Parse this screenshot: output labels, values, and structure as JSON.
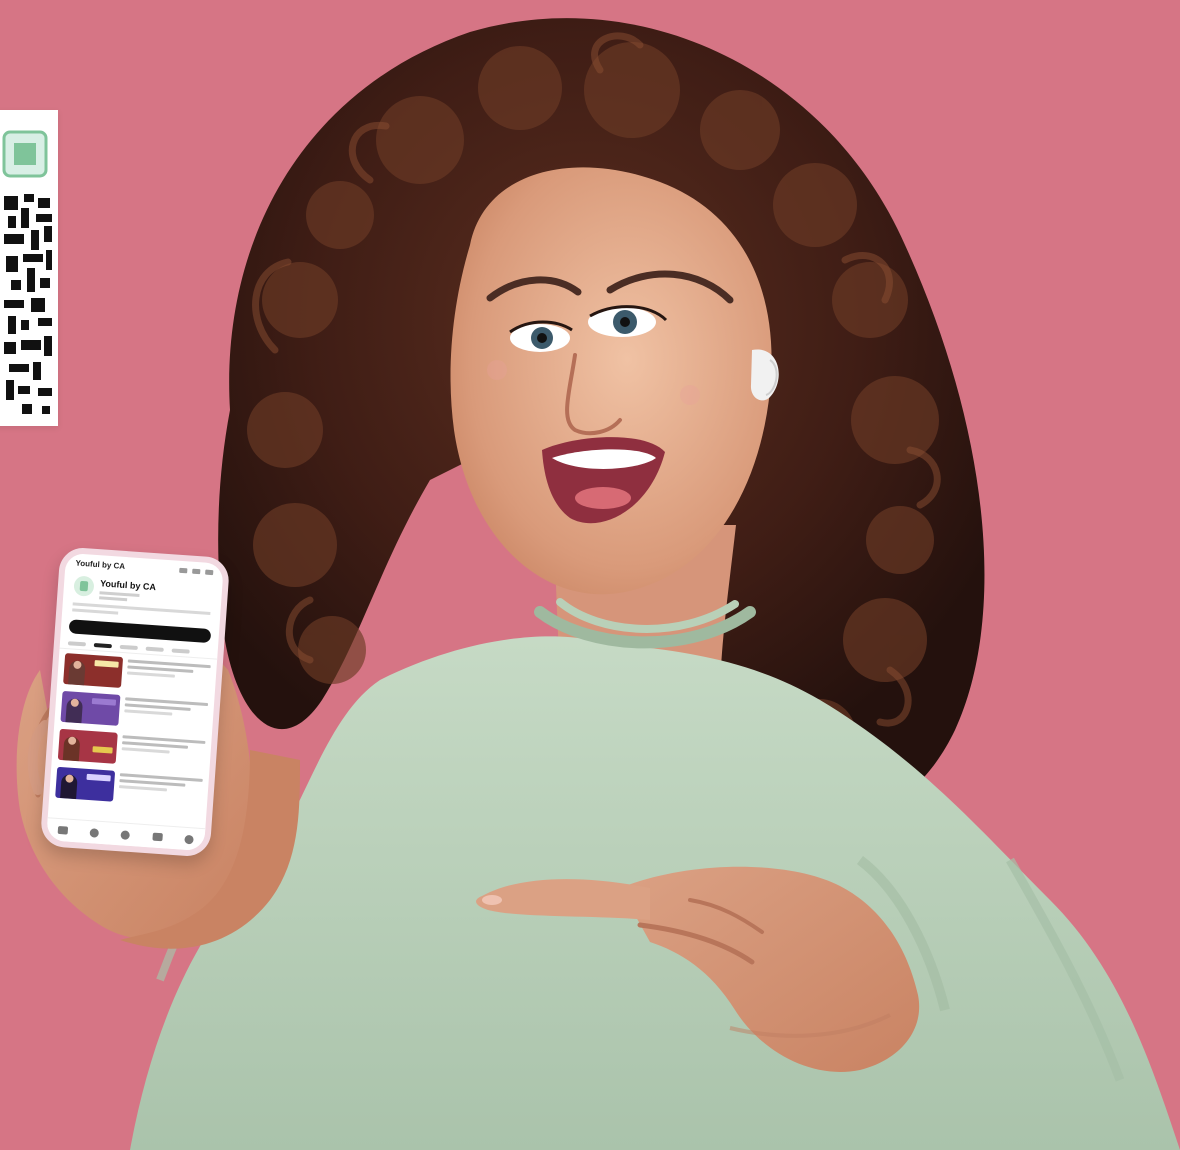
{
  "phone": {
    "screen_title": "Youful by CA",
    "channel_name": "Youful by CA",
    "tabs_count_visible": 5,
    "video_count_visible": 4,
    "colors": {
      "background": "#d67585",
      "sweater": "#b8d0b9",
      "phone_case": "#f2d9e1",
      "qr_accent": "#7fc49a"
    },
    "icons": [
      "qr-code",
      "youtube-app-screen",
      "home-icon",
      "shorts-icon",
      "add-icon",
      "subscriptions-icon",
      "library-icon"
    ]
  }
}
